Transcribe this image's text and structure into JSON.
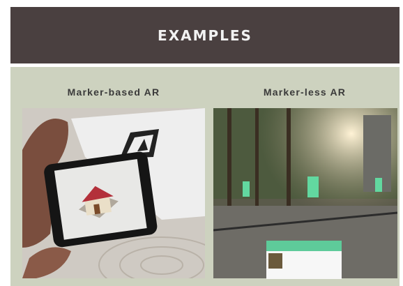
{
  "header": {
    "title": "EXAMPLES"
  },
  "left": {
    "caption": "Marker-based AR"
  },
  "right": {
    "caption": "Marker-less AR"
  },
  "colors": {
    "header_bg": "#4a4040",
    "panel_bg": "#cdd2bf",
    "card_accent": "#5ecb9a"
  }
}
